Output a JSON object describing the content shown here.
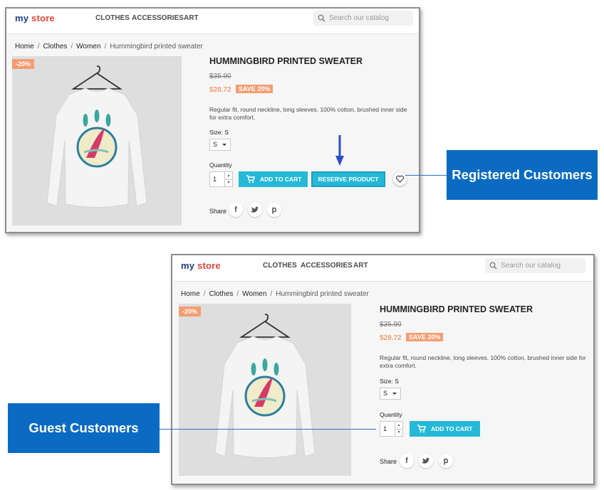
{
  "store": {
    "logo_a": "my",
    "logo_b": "store",
    "nav": [
      "CLOTHES",
      "ACCESSORIES",
      "ART"
    ],
    "search_placeholder": "Search our catalog"
  },
  "breadcrumb": [
    "Home",
    "Clothes",
    "Women",
    "Hummingbird printed sweater"
  ],
  "product": {
    "discount_badge": "-20%",
    "title": "HUMMINGBIRD PRINTED SWEATER",
    "old_price": "$35.90",
    "price": "$28.72",
    "save_badge": "SAVE 20%",
    "description": "Regular fit, round neckline, long sleeves. 100% cotton, brushed inner side for extra comfort.",
    "size_label": "Size: S",
    "size_value": "S",
    "quantity_label": "Quantity",
    "quantity_value": "1",
    "add_to_cart": "ADD TO CART",
    "reserve": "RESERVE PRODUCT",
    "share_label": "Share",
    "social_icons": [
      "facebook-icon",
      "twitter-icon",
      "pinterest-icon"
    ]
  },
  "callouts": {
    "registered": "Registered Customers",
    "guest": "Guest Customers"
  },
  "colors": {
    "accent": "#25b9d7",
    "discount": "#f39d72",
    "callout": "#0b6bc2",
    "arrow": "#2a4fc9"
  }
}
